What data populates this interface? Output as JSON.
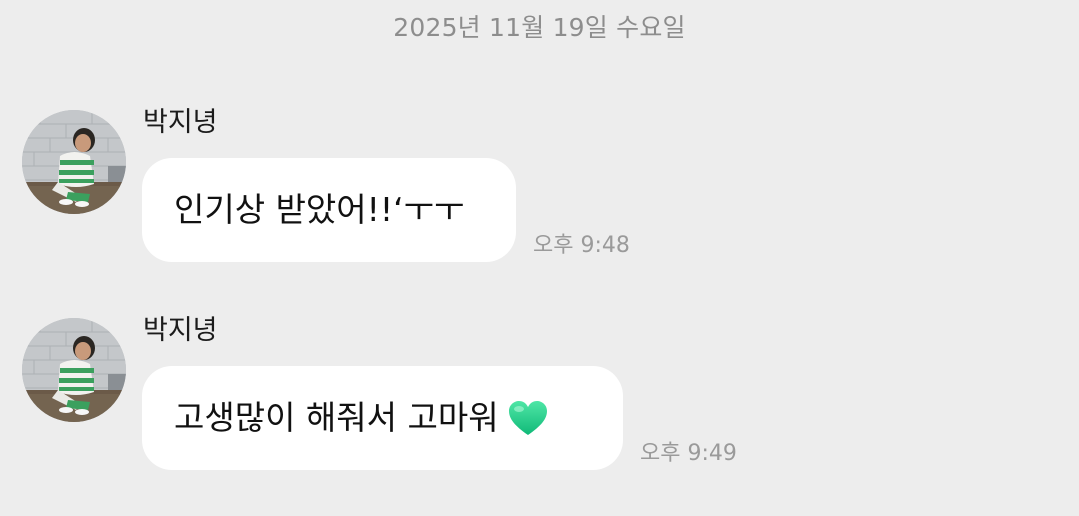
{
  "chat": {
    "date_divider": "2025년 11월 19일 수요일",
    "messages": [
      {
        "sender": "박지녕",
        "text": "인기상 받았어!!‘ㅜㅜ",
        "emoji": "",
        "time": "오후 9:48",
        "avatar_icon": "profile-photo-avatar"
      },
      {
        "sender": "박지녕",
        "text": "고생많이 해줘서 고마워",
        "emoji": "green-heart-icon",
        "time": "오후 9:49",
        "avatar_icon": "profile-photo-avatar"
      }
    ]
  },
  "colors": {
    "background": "#ededed",
    "bubble": "#ffffff",
    "date_text": "#8d8d8d",
    "timestamp_text": "#9a9a9a",
    "heart": "#1fd08c"
  }
}
